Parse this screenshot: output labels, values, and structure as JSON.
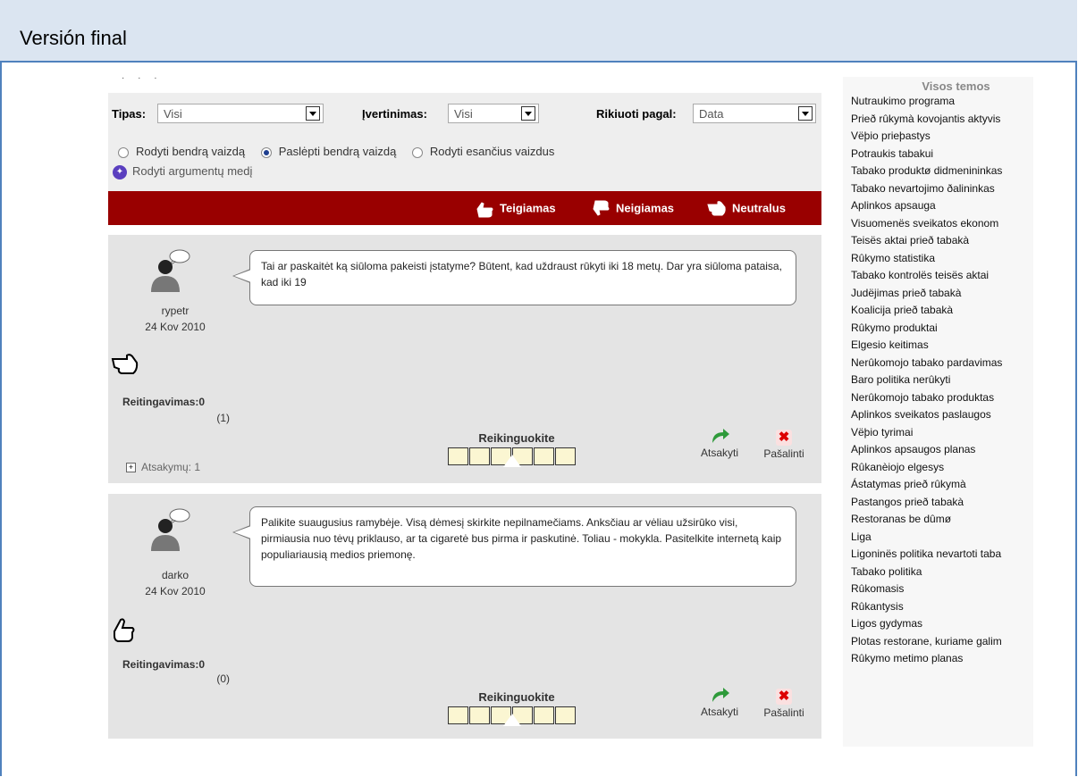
{
  "doc_title": "Versión final",
  "filters": {
    "type_label": "Tipas:",
    "type_value": "Visi",
    "rating_label": "Įvertinimas:",
    "rating_value": "Visi",
    "sort_label": "Rikiuoti pagal:",
    "sort_value": "Data",
    "radio_options": [
      "Rodyti bendrą vaizdą",
      "Paslėpti bendrą vaizdą",
      "Rodyti esančius vaizdus"
    ],
    "selected_radio": 1,
    "tree_link": "Rodyti argumentų medį"
  },
  "legend": {
    "positive": "Teigiamas",
    "negative": "Neigiamas",
    "neutral": "Neutralus",
    "color": "#990000"
  },
  "comments": [
    {
      "text": "Tai ar paskaitėt ką siūloma pakeisti įstatyme? Būtent, kad uždraust rūkyti iki 18 metų. Dar yra siūloma pataisa, kad iki 19",
      "user": "rypetr",
      "date": "24 Kov 2010",
      "sentiment_icon": "neutral-hand-icon",
      "rating_label": "Reitingavimas:0",
      "rating_count": "(1)",
      "rate_title": "Reikinguokite",
      "reply": "Atsakyti",
      "delete": "Pašalinti",
      "answers": "Atsakymų: 1"
    },
    {
      "text": "Palikite suaugusius ramybėje. Visą dėmesį skirkite nepilnamečiams. Anksčiau ar vėliau užsirūko visi, pirmiausia nuo tėvų priklauso, ar ta cigaretė bus pirma ir paskutinė. Toliau - mokykla. Pasitelkite internetą kaip populiariausią medios priemonę.",
      "user": "darko",
      "date": "24 Kov 2010",
      "sentiment_icon": "positive-hand-icon",
      "rating_label": "Reitingavimas:0",
      "rating_count": "(0)",
      "rate_title": "Reikinguokite",
      "reply": "Atsakyti",
      "delete": "Pašalinti"
    }
  ],
  "sidebar": {
    "title": "Visos temos",
    "topics": [
      "Nutraukimo programa",
      "Prieð rûkymà kovojantis aktyvis",
      "Vëþio prieþastys",
      "Potraukis tabakui",
      "Tabako produktø didmenininkas",
      "Tabako nevartojimo ðalininkas",
      "Aplinkos apsauga",
      "Visuomenës sveikatos ekonom",
      "Teisës aktai prieð tabakà",
      "Rûkymo statistika",
      "Tabako kontrolës teisës aktai",
      "Judëjimas prieð tabakà",
      "Koalicija prieð tabakà",
      "Rûkymo produktai",
      "Elgesio keitimas",
      "Nerûkomojo tabako pardavimas",
      "Baro politika nerûkyti",
      "Nerûkomojo tabako produktas",
      "Aplinkos sveikatos paslaugos",
      "Vëþio tyrimai",
      "Aplinkos apsaugos planas",
      "Rûkanèiojo elgesys",
      "Ástatymas prieð rûkymà",
      "Pastangos prieð tabakà",
      "Restoranas be dûmø",
      "Liga",
      "Ligoninës politika nevartoti taba",
      "Tabako politika",
      "Rûkomasis",
      "Rûkantysis",
      "Ligos gydymas",
      "Plotas restorane, kuriame galim",
      "Rûkymo metimo planas"
    ]
  }
}
